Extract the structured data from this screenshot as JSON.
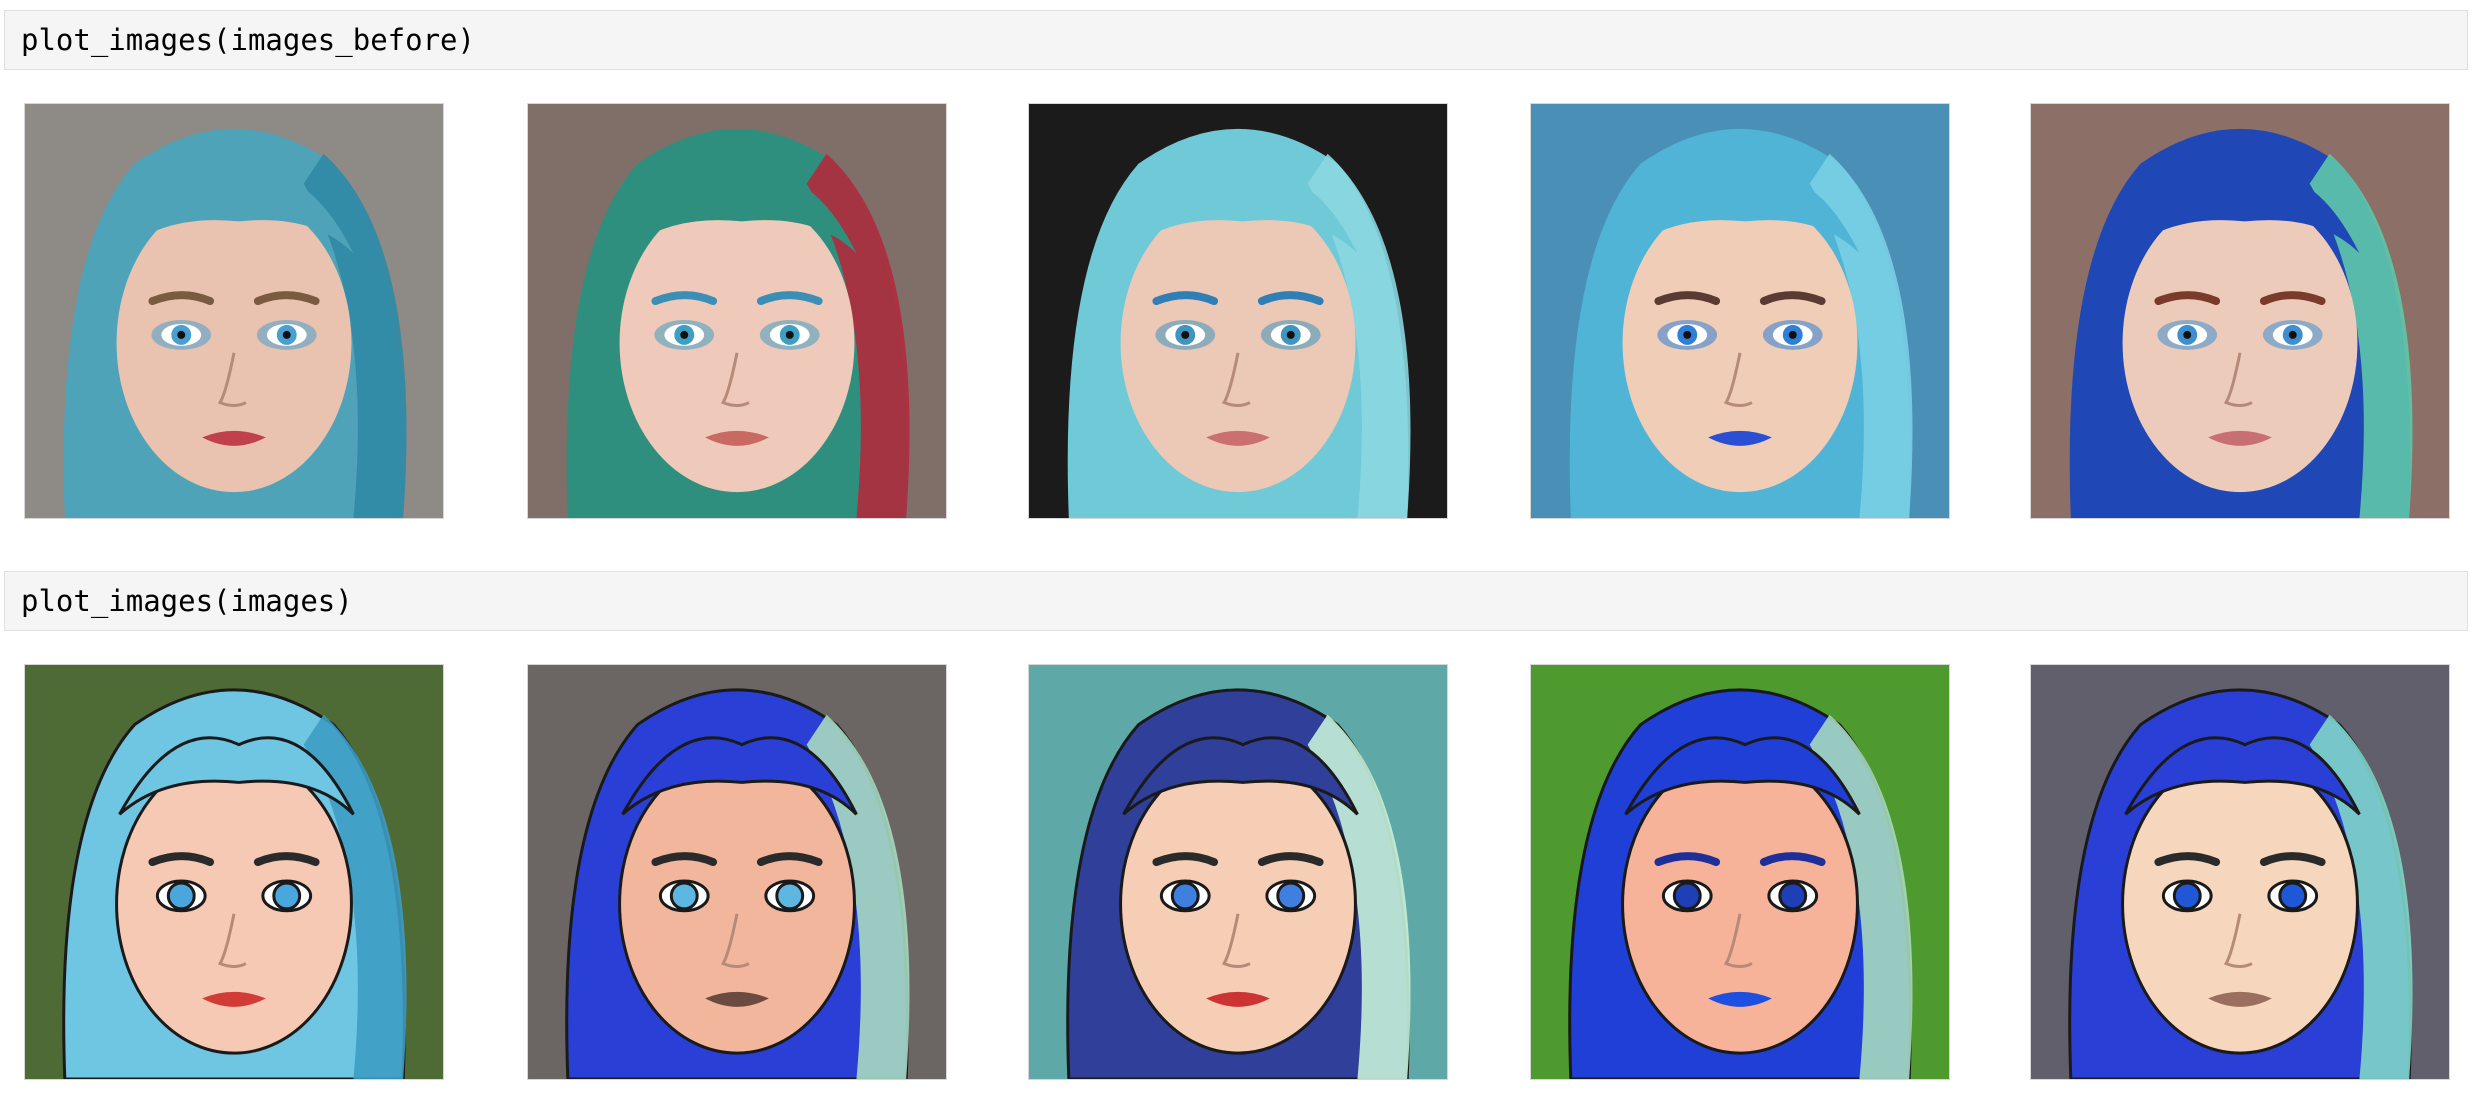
{
  "cells": [
    {
      "code": "plot_images(images_before)"
    },
    {
      "code": "plot_images(images)"
    }
  ],
  "rows": [
    {
      "kind": "photo",
      "images": [
        {
          "bg": "#8e8a85",
          "hair": "#4fa3b8",
          "hair2": "#2f8aa5",
          "skin": "#e9c3b0",
          "eye": "#4a9fd1",
          "lip": "#c0414c",
          "brow": "#7a5a40"
        },
        {
          "bg": "#7f6f68",
          "hair": "#2f8f7f",
          "hair2": "#b32a3c",
          "skin": "#efc9b9",
          "eye": "#3f9fc2",
          "lip": "#c86a62",
          "brow": "#3b8fb7"
        },
        {
          "bg": "#1b1b1b",
          "hair": "#6fc9d6",
          "hair2": "#8bd7e0",
          "skin": "#ecc8b6",
          "eye": "#3f95bd",
          "lip": "#cc6f70",
          "brow": "#2f7fb6"
        },
        {
          "bg": "#4a8fb6",
          "hair": "#4fb4d6",
          "hair2": "#79cfe6",
          "skin": "#f0cdb7",
          "eye": "#2f7fd8",
          "lip": "#2a4fd2",
          "brow": "#5a3a33"
        },
        {
          "bg": "#8c6f67",
          "hair": "#1f47b5",
          "hair2": "#5ec7a8",
          "skin": "#eccbbb",
          "eye": "#3f8fd0",
          "lip": "#c86f72",
          "brow": "#7a3b2b"
        }
      ]
    },
    {
      "kind": "cartoon",
      "images": [
        {
          "bg": "#4f6b35",
          "hair": "#6fc6e2",
          "hair2": "#3d9cc4",
          "skin": "#f6c9b4",
          "eye": "#4aa7dd",
          "lip": "#d23c36",
          "brow": "#2a2a2a"
        },
        {
          "bg": "#6b6664",
          "hair": "#2a3fd6",
          "hair2": "#a6d9bf",
          "skin": "#f2b69c",
          "eye": "#5db7e0",
          "lip": "#6b4a40",
          "brow": "#2a2a2a"
        },
        {
          "bg": "#5fa8a8",
          "hair": "#2f3f9a",
          "hair2": "#c7efd8",
          "skin": "#f6cdb5",
          "eye": "#3f7fe0",
          "lip": "#cc3333",
          "brow": "#2a2a2a"
        },
        {
          "bg": "#4f9a2f",
          "hair": "#1f3fd6",
          "hair2": "#a6d9bf",
          "skin": "#f6b39a",
          "eye": "#1f3fb6",
          "lip": "#1f4fe0",
          "brow": "#1f2f9a"
        },
        {
          "bg": "#615f6b",
          "hair": "#2a3fd6",
          "hair2": "#7fd6c9",
          "skin": "#f6d6bc",
          "eye": "#1f57d6",
          "lip": "#9b6f5f",
          "brow": "#2a2a2a"
        }
      ]
    }
  ]
}
